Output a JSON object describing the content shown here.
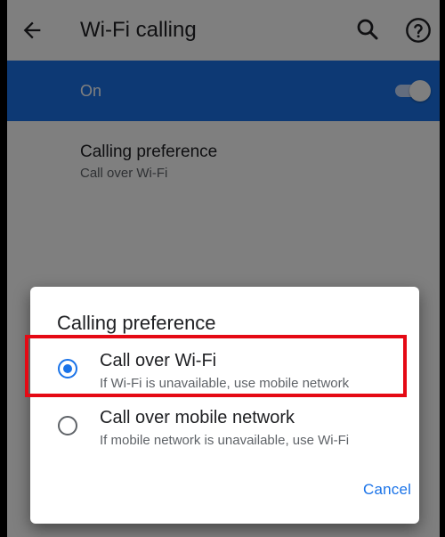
{
  "appbar": {
    "title": "Wi-Fi calling",
    "back_icon": "arrow-back-icon",
    "search_icon": "search-icon",
    "help_icon": "help-circle-icon"
  },
  "master_switch": {
    "label": "On",
    "state": "on",
    "background_color": "#1a73e8"
  },
  "preference_row": {
    "title": "Calling preference",
    "summary": "Call over Wi-Fi"
  },
  "dialog": {
    "title": "Calling preference",
    "options": [
      {
        "title": "Call over Wi-Fi",
        "subtitle": "If Wi-Fi is unavailable, use mobile network",
        "selected": true
      },
      {
        "title": "Call over mobile network",
        "subtitle": "If mobile network is unavailable, use Wi-Fi",
        "selected": false
      }
    ],
    "cancel_label": "Cancel"
  },
  "colors": {
    "accent": "#1a73e8",
    "highlight_box": "#e50914"
  }
}
